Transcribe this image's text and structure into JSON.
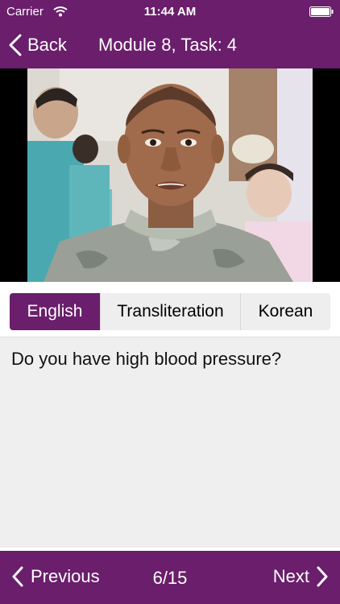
{
  "status_bar": {
    "carrier": "Carrier",
    "time": "11:44 AM"
  },
  "nav": {
    "back_label": "Back",
    "title": "Module 8, Task: 4"
  },
  "segments": [
    {
      "label": "English",
      "selected": true
    },
    {
      "label": "Transliteration",
      "selected": false
    },
    {
      "label": "Korean",
      "selected": false
    }
  ],
  "phrase": {
    "text": "Do you have high blood pressure?"
  },
  "footer": {
    "previous_label": "Previous",
    "counter": "6/15",
    "next_label": "Next"
  },
  "colors": {
    "accent": "#6a1e6b",
    "card_background": "#efefef",
    "segment_inactive": "#eeeeee"
  },
  "icons": {
    "wifi": "wifi-icon",
    "battery": "battery-icon",
    "back": "chevron-left-icon",
    "previous": "chevron-left-icon",
    "next": "chevron-right-icon"
  }
}
